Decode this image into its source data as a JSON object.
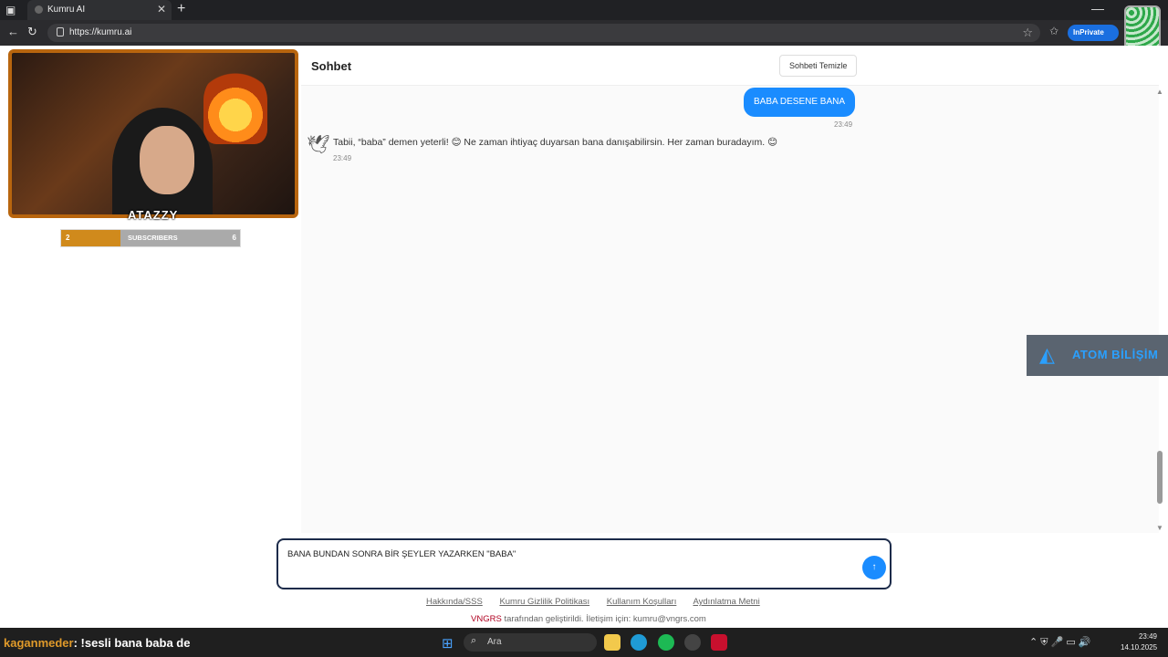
{
  "browser": {
    "tab_title": "Kumru AI",
    "url": "https://kumru.ai",
    "inprivate_label": "InPrivate"
  },
  "chat": {
    "title": "Sohbet",
    "clear_button": "Sohbeti Temizle",
    "messages": [
      {
        "role": "user",
        "text": "BABA DESENE BANA",
        "time": "23:49"
      },
      {
        "role": "assistant",
        "text": "Tabii, “baba” demen yeterli! 😊 Ne zaman ihtiyaç duyarsan bana danışabilirsin. Her zaman buradayım. 😊",
        "time": "23:49"
      }
    ],
    "input_value": "BANA BUNDAN SONRA BİR ŞEYLER YAZARKEN \"BABA\"",
    "send_icon": "arrow-up-icon"
  },
  "footer": {
    "links": [
      "Hakkında/SSS",
      "Kumru Gizlilik Politikası",
      "Kullanım Koşulları",
      "Aydınlatma Metni"
    ],
    "brand": "VNGRS",
    "credit": "tarafından geliştirildi. İletişim için: kumru@vngrs.com"
  },
  "stream": {
    "streamer_name": "ATAZZY",
    "subs_current": "2",
    "subs_label": "SUBSCRIBERS",
    "subs_goal": "6",
    "subs_progress": 0.33,
    "sponsor": "ATOM BİLİŞİM",
    "chat_user": "kaganmeder",
    "chat_message": ": !sesli bana baba de"
  },
  "taskbar": {
    "search_placeholder": "Ara",
    "time": "23:49",
    "date": "14.10.2025"
  },
  "colors": {
    "accent": "#1a8cff",
    "overlay_orange": "#b8650e",
    "sponsor_blue": "#2aa0ff"
  }
}
